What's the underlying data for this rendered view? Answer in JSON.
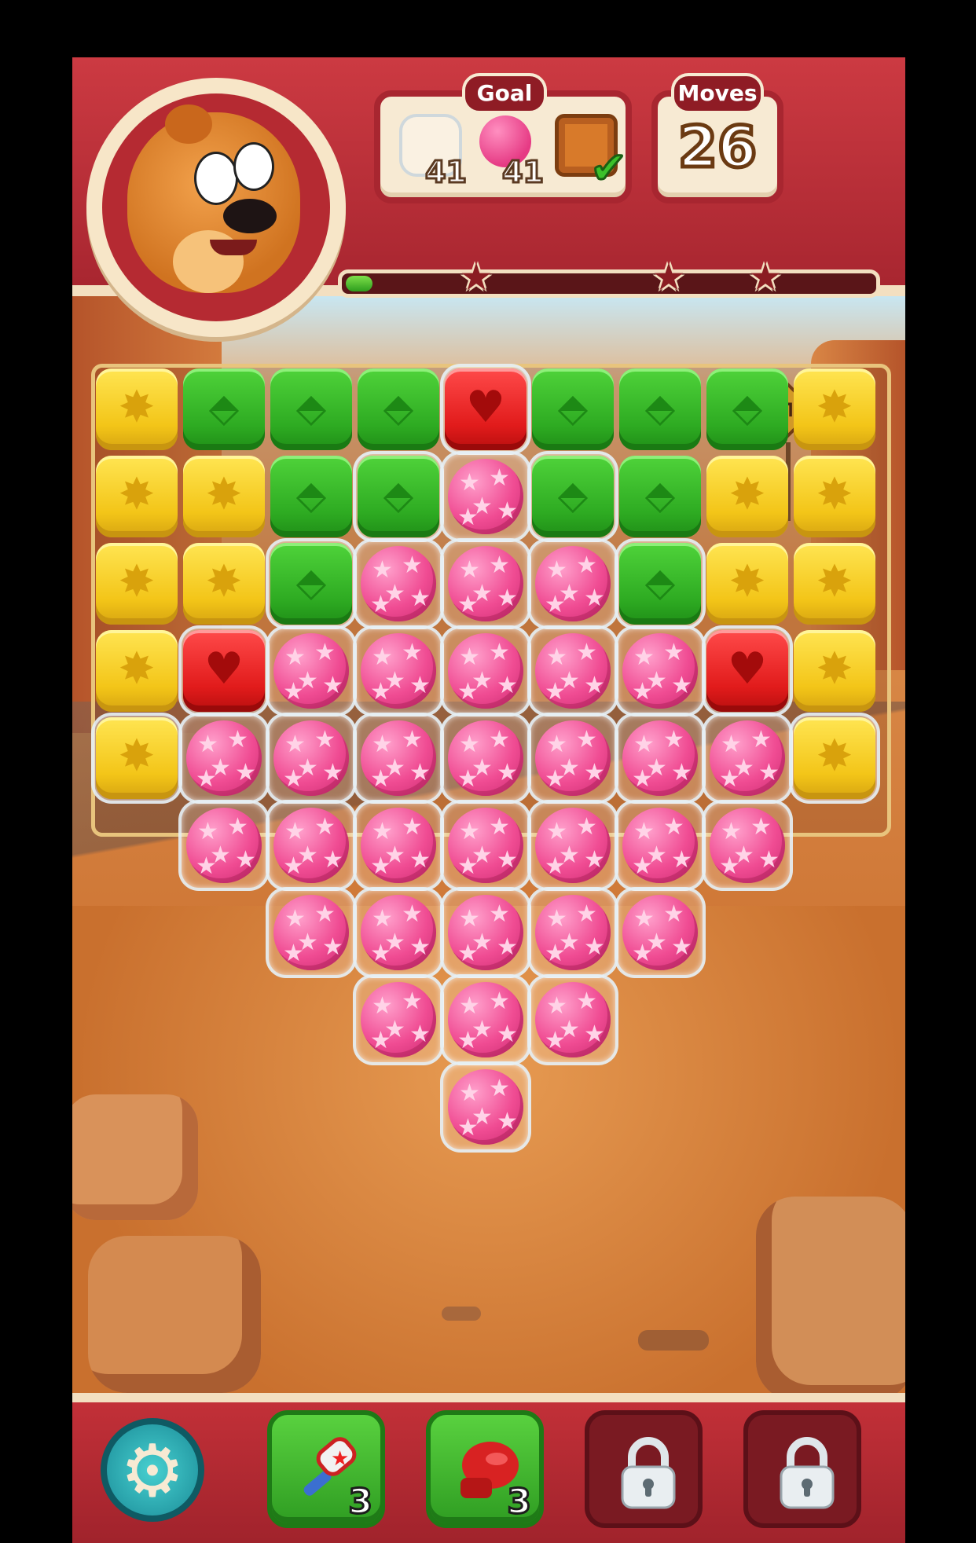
{
  "hud": {
    "goal_label": "Goal",
    "moves_label": "Moves",
    "moves_value": "26",
    "goals": [
      {
        "icon": "bubble-icon",
        "count": "41"
      },
      {
        "icon": "pink-ball-icon",
        "count": "41"
      },
      {
        "icon": "crate-icon",
        "completed": true
      }
    ],
    "progress": 0.05,
    "stars": 3
  },
  "board": {
    "legend": {
      "Y": "yellow-star-cube",
      "G": "green-rocket-cube",
      "R": "red-heart-cube",
      "B": "pink-star-ball",
      ".": "empty"
    },
    "rows": [
      "YGGGRGGGY",
      "YYGGBGGYY",
      "YYGBBBGYY",
      "YRBBBBBRY",
      "YBBBBBBBY",
      ".BBBBBBB.",
      "..BBBBB..",
      "...BBB...",
      "....B...."
    ],
    "bubbles": [
      [
        0,
        4
      ],
      [
        1,
        3
      ],
      [
        1,
        4
      ],
      [
        1,
        5
      ],
      [
        2,
        2
      ],
      [
        2,
        3
      ],
      [
        2,
        4
      ],
      [
        2,
        5
      ],
      [
        2,
        6
      ],
      [
        3,
        1
      ],
      [
        3,
        2
      ],
      [
        3,
        3
      ],
      [
        3,
        4
      ],
      [
        3,
        5
      ],
      [
        3,
        6
      ],
      [
        3,
        7
      ],
      [
        4,
        0
      ],
      [
        4,
        1
      ],
      [
        4,
        2
      ],
      [
        4,
        3
      ],
      [
        4,
        4
      ],
      [
        4,
        5
      ],
      [
        4,
        6
      ],
      [
        4,
        7
      ],
      [
        4,
        8
      ],
      [
        5,
        1
      ],
      [
        5,
        2
      ],
      [
        5,
        3
      ],
      [
        5,
        4
      ],
      [
        5,
        5
      ],
      [
        5,
        6
      ],
      [
        5,
        7
      ],
      [
        6,
        2
      ],
      [
        6,
        3
      ],
      [
        6,
        4
      ],
      [
        6,
        5
      ],
      [
        6,
        6
      ],
      [
        7,
        3
      ],
      [
        7,
        4
      ],
      [
        7,
        5
      ],
      [
        8,
        4
      ]
    ]
  },
  "boosters": [
    {
      "name": "settings",
      "icon": "gear-icon"
    },
    {
      "name": "hammer",
      "icon": "hammer-icon",
      "count": "3"
    },
    {
      "name": "boxing-glove",
      "icon": "boxing-glove-icon",
      "count": "3"
    },
    {
      "name": "locked-1",
      "icon": "lock-icon"
    },
    {
      "name": "locked-2",
      "icon": "lock-icon"
    }
  ],
  "colors": {
    "hud_red": "#c7343c",
    "cream": "#f7ead3",
    "yellow": "#f3c518",
    "green": "#2eab22",
    "red": "#e11b1b",
    "pink": "#f04c93"
  }
}
